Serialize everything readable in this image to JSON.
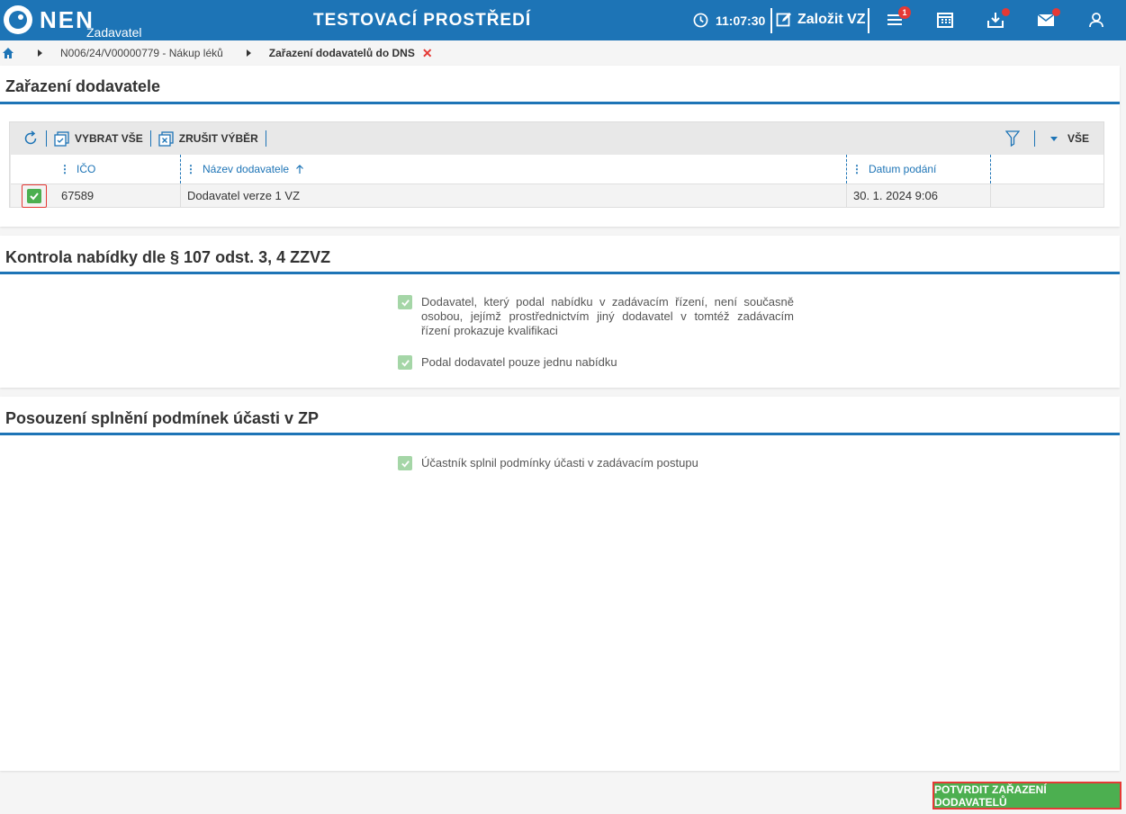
{
  "header": {
    "logo_text": "NEN",
    "logo_sub": "Zadavatel",
    "environment": "TESTOVACÍ PROSTŘEDÍ",
    "time": "11:07:30",
    "new_button": "Založit VZ",
    "menu_badge": "1",
    "accent": "#1d74b6"
  },
  "breadcrumb": {
    "items": [
      "N006/24/V00000779 - Nákup léků"
    ],
    "current": "Zařazení dodavatelů do DNS",
    "close_glyph": "✕"
  },
  "section_supplier": {
    "title": "Zařazení dodavatele",
    "toolbar": {
      "select_all": "VYBRAT VŠE",
      "clear_selection": "ZRUŠIT VÝBĚR",
      "filter_value": "VŠE"
    },
    "columns": {
      "ico": "IČO",
      "name": "Název dodavatele",
      "date": "Datum podání"
    },
    "rows": [
      {
        "ico": "67589",
        "name": "Dodavatel verze 1 VZ",
        "date": "30. 1. 2024 9:06",
        "checked": true
      }
    ]
  },
  "section_control": {
    "title": "Kontrola nabídky dle § 107 odst. 3, 4 ZZVZ",
    "checks": [
      "Dodavatel, který podal nabídku v zadávacím řízení, není současně osobou, jejímž prostřednictvím jiný dodavatel v tomtéž zadávacím řízení prokazuje kvalifikaci",
      "Podal dodavatel pouze jednu nabídku"
    ]
  },
  "section_conditions": {
    "title": "Posouzení splnění podmínek účasti v ZP",
    "checks": [
      "Účastník splnil podmínky účasti v zadávacím postupu"
    ]
  },
  "footer": {
    "confirm_button": "POTVRDIT ZAŘAZENÍ DODAVATELŮ"
  }
}
